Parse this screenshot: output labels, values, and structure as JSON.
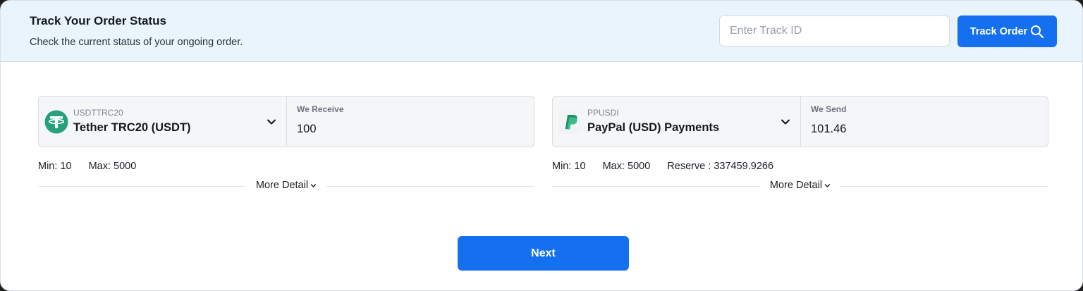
{
  "tracker": {
    "title": "Track Your Order Status",
    "subtitle": "Check the current status of your ongoing order.",
    "input_placeholder": "Enter Track ID",
    "button_label": "Track Order"
  },
  "exchange": {
    "send": {
      "code": "USDTTRC20",
      "name": "Tether TRC20 (USDT)",
      "amount_label": "We Receive",
      "amount": "100",
      "min": "Min: 10",
      "max": "Max: 5000",
      "more_detail": "More Detail",
      "icon": "tether-logo-icon",
      "color": "#26a17b"
    },
    "receive": {
      "code": "PPUSDI",
      "name": "PayPal (USD) Payments",
      "amount_label": "We Send",
      "amount": "101.46",
      "min": "Min: 10",
      "max": "Max: 5000",
      "reserve": "Reserve : 337459.9266",
      "more_detail": "More Detail",
      "icon": "paypal-logo-icon",
      "color": "#2fa37a"
    }
  },
  "actions": {
    "next_label": "Next"
  },
  "colors": {
    "accent": "#1570ef",
    "header_bg": "#eaf4fd"
  }
}
